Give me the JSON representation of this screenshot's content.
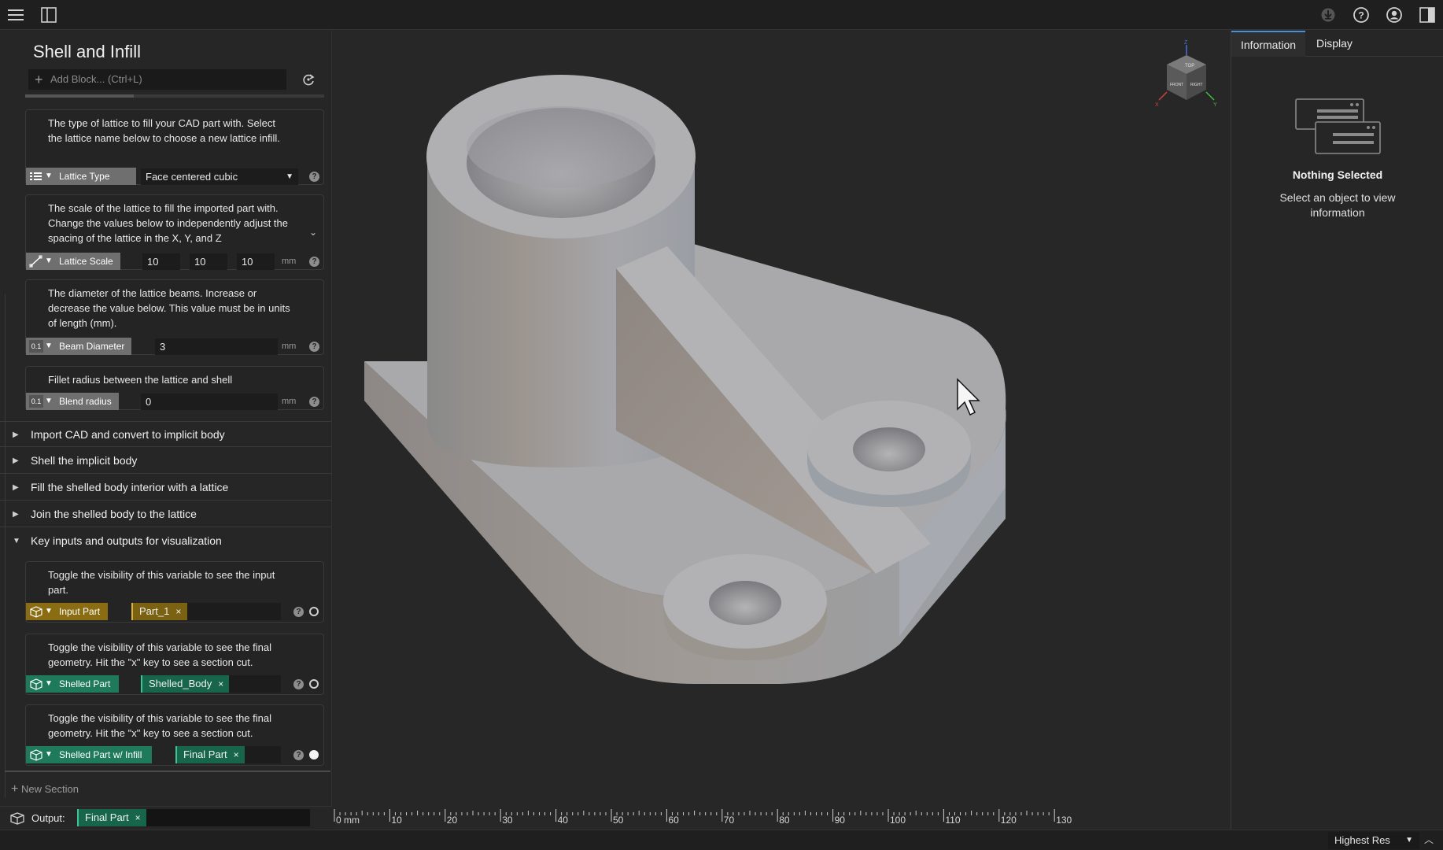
{
  "app": {
    "panel_title": "Shell and Infill"
  },
  "toolbar": {
    "add_block_placeholder": "Add Block... (Ctrl+L)"
  },
  "blocks": {
    "lattice_type": {
      "desc": "The type of lattice to fill your CAD part with. Select the lattice name below to choose a new lattice infill.",
      "label": "Lattice Type",
      "value": "Face centered cubic"
    },
    "lattice_scale": {
      "desc": "The scale of the lattice to fill the imported part with. Change the values below to independently adjust the spacing of the lattice in the X, Y, and Z",
      "label": "Lattice Scale",
      "x": "10",
      "y": "10",
      "z": "10",
      "unit": "mm"
    },
    "beam_diameter": {
      "desc": "The diameter of the lattice beams. Increase or decrease the value below. This value must be in units of length (mm).",
      "label": "Beam Diameter",
      "value": "3",
      "unit": "mm",
      "type_hint": "0.1"
    },
    "blend_radius": {
      "desc": "Fillet radius between the lattice and shell",
      "label": "Blend radius",
      "value": "0",
      "unit": "mm",
      "type_hint": "0.1"
    },
    "input_part": {
      "desc": "Toggle the visibility of this variable to see the input part.",
      "label": "Input Part",
      "chip": "Part_1"
    },
    "shelled_part": {
      "desc": "Toggle the visibility of this variable to see the final geometry. Hit the \"x\" key to see a section cut.",
      "label": "Shelled Part",
      "chip": "Shelled_Body"
    },
    "shelled_infill": {
      "desc": "Toggle the visibility of this variable to see the final geometry. Hit the \"x\" key to see a section cut.",
      "label": "Shelled Part w/ Infill",
      "chip": "Final Part"
    }
  },
  "sections": [
    "Import CAD and convert to implicit body",
    "Shell the implicit body",
    "Fill the shelled body interior with a lattice",
    "Join the shelled body to the lattice",
    "Key inputs and outputs for visualization"
  ],
  "new_section": "New Section",
  "output": {
    "label": "Output:",
    "chip": "Final Part"
  },
  "help_glyph": "?",
  "chip_close": "×",
  "ruler": {
    "labels": [
      "0 mm",
      "10",
      "20",
      "30",
      "40",
      "50",
      "60",
      "70",
      "80",
      "90",
      "100",
      "110",
      "120",
      "130"
    ]
  },
  "view_cube": {
    "faces": [
      "TOP",
      "FRONT",
      "RIGHT"
    ],
    "axes": [
      "Z",
      "X",
      "Y"
    ]
  },
  "right_panel": {
    "tabs": [
      "Information",
      "Display"
    ],
    "empty_title": "Nothing Selected",
    "empty_sub": "Select an object to view information"
  },
  "status": {
    "resolution": "Highest Res"
  },
  "colors": {
    "tag_gray": "#6f6f6f",
    "tag_gold": "#8a6d12",
    "tag_teal": "#1f7a5c",
    "chip_gold": "#7a6212",
    "chip_teal": "#17664c",
    "accent": "#4a90d9"
  },
  "icons": [
    "menu-icon",
    "sidebar-toggle-icon",
    "download-icon",
    "help-icon",
    "account-icon",
    "panel-toggle-icon",
    "refresh-icon",
    "list-icon",
    "ruler-icon",
    "number-icon",
    "part-icon",
    "cursor-icon"
  ]
}
